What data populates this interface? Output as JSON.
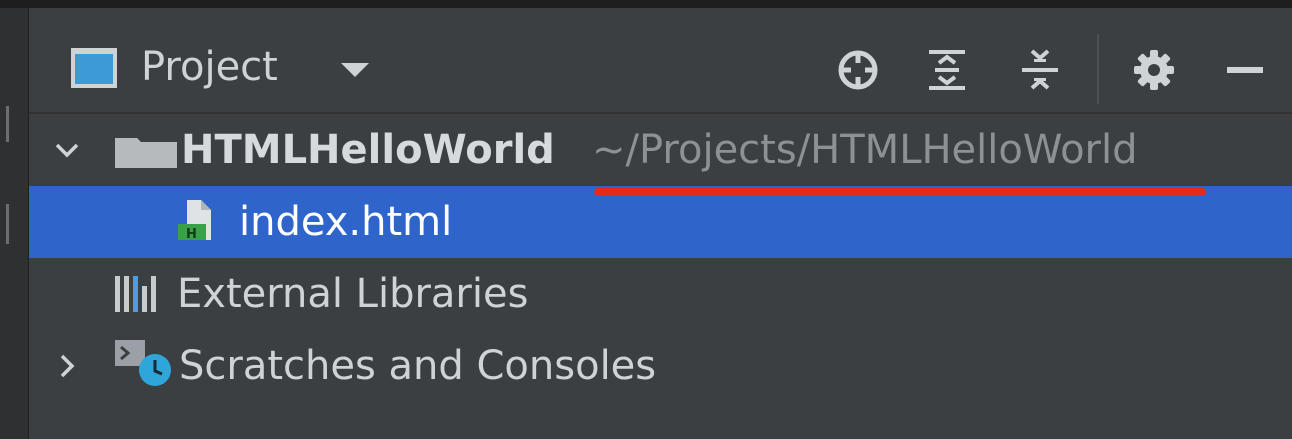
{
  "header": {
    "title": "Project",
    "icons": [
      "project-view-icon",
      "dropdown-caret-icon",
      "locate-icon",
      "expand-all-icon",
      "collapse-all-icon",
      "gear-icon",
      "minimize-icon"
    ]
  },
  "tree": {
    "root": {
      "name": "HTMLHelloWorld",
      "path": "~/Projects/HTMLHelloWorld",
      "expanded": true
    },
    "children": [
      {
        "name": "index.html",
        "selected": true,
        "icon": "html-file-icon"
      }
    ],
    "external_libraries": {
      "name": "External Libraries",
      "icon": "libraries-icon"
    },
    "scratches": {
      "name": "Scratches and Consoles",
      "icon": "scratches-icon",
      "expanded": false
    }
  },
  "colors": {
    "panel_bg": "#3c3f41",
    "selection": "#2f65ca",
    "annotation": "#e42a1f",
    "text": "#cfd3d6",
    "path_text": "#8e9194"
  }
}
